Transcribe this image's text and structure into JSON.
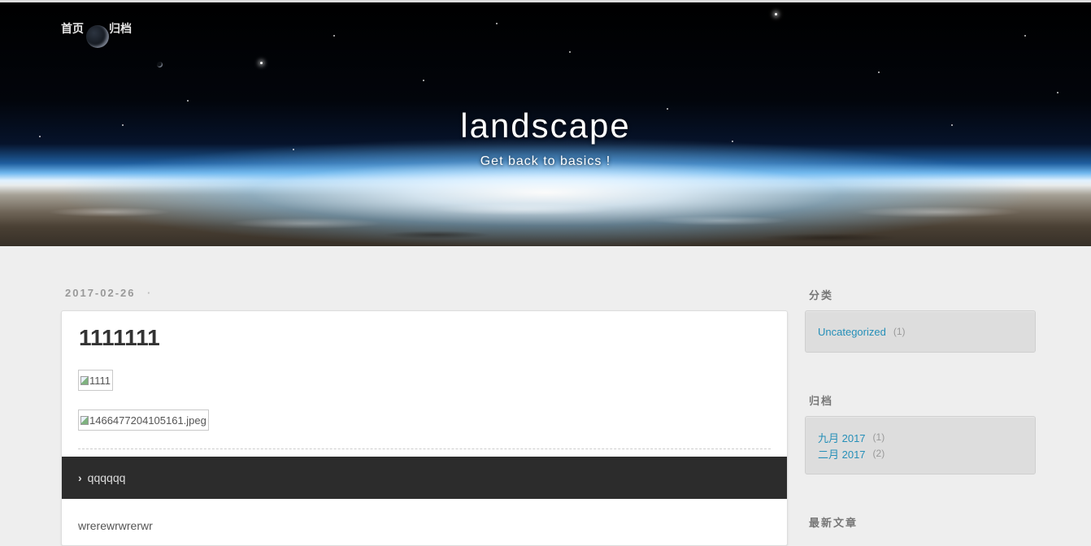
{
  "header": {
    "nav": [
      {
        "label": "首页"
      },
      {
        "label": "归档"
      }
    ],
    "title": "landscape",
    "subtitle": "Get back to basics !"
  },
  "article": {
    "date": "2017-02-26",
    "date_sep": "·",
    "title": "1111111",
    "images": [
      {
        "alt": "1111"
      },
      {
        "alt": "1466477204105161.jpeg"
      }
    ],
    "toc": {
      "chevron": "›",
      "label": "qqqqqq"
    },
    "body_preview": "wrerewrwrerwr"
  },
  "sidebar": {
    "categories": {
      "title": "分类",
      "items": [
        {
          "label": "Uncategorized",
          "count": "(1)"
        }
      ]
    },
    "archives": {
      "title": "归档",
      "items": [
        {
          "label": "九月 2017",
          "count": "(1)"
        },
        {
          "label": "二月 2017",
          "count": "(2)"
        }
      ]
    },
    "recent": {
      "title": "最新文章"
    }
  },
  "colors": {
    "link": "#258fb8",
    "toc_bar": "#2c2c2c",
    "page_bg": "#eeeeee",
    "widget_bg": "#dddddd"
  }
}
